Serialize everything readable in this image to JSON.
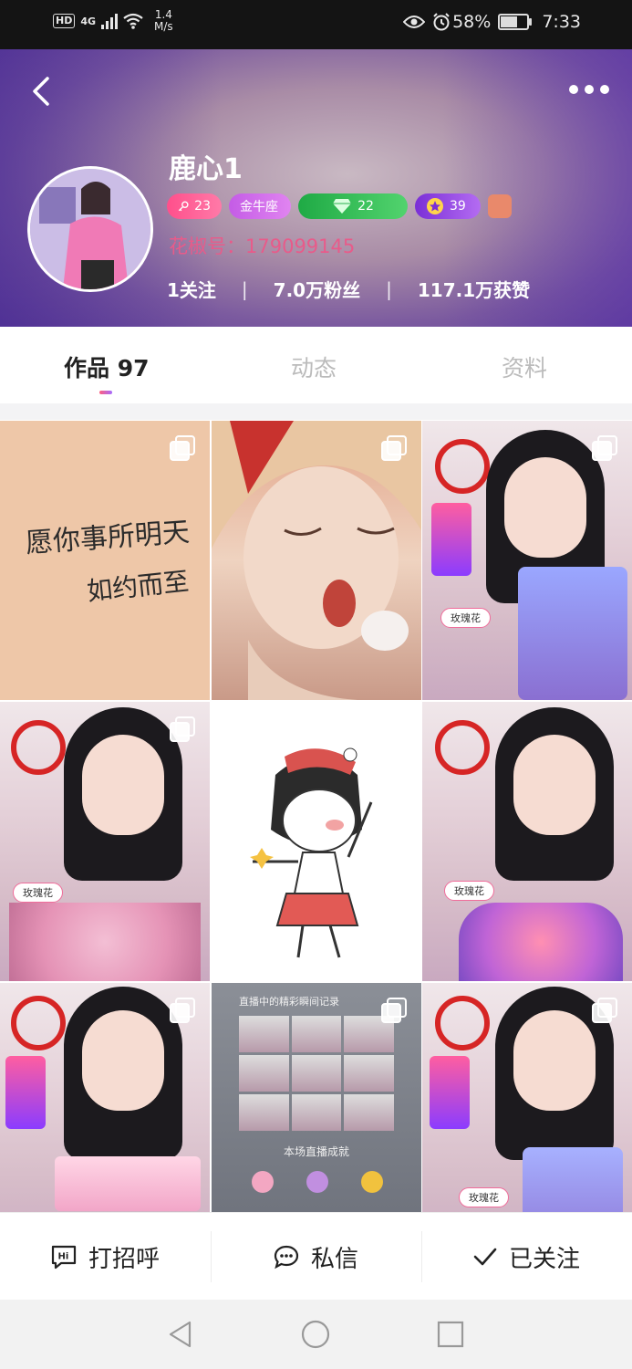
{
  "status_bar": {
    "left_badge": "HD",
    "network": "4G",
    "speed_value": "1.4",
    "speed_unit": "M/s",
    "battery": "58%",
    "time": "7:33",
    "battery_level": 0.58
  },
  "header": {
    "nickname": "鹿心1",
    "level_badge": "23",
    "zodiac_badge": "金牛座",
    "fans_badge": "22",
    "vip_badge": "39",
    "user_id": "花椒号：179099145",
    "stats": {
      "following": "1关注",
      "fans": "7.0万粉丝",
      "likes": "117.1万获赞",
      "separator": "|"
    }
  },
  "tabs": [
    {
      "label": "作品 97"
    },
    {
      "label": "动态"
    },
    {
      "label": "资料"
    }
  ],
  "grid": {
    "cell1": {
      "line1": "愿你事所明天",
      "line2": "如约而至"
    },
    "cell3": {
      "tag": "玫瑰花"
    },
    "cell4": {
      "tag": "玫瑰花"
    },
    "cell6": {
      "tag": "玫瑰花"
    },
    "cell8": {
      "title": "直播中的精彩瞬间记录",
      "subtitle": "本场直播成就"
    },
    "cell9": {
      "tag": "玫瑰花"
    }
  },
  "actions": {
    "greet": "打招呼",
    "message": "私信",
    "follow": "已关注"
  },
  "icons": {
    "back": "back-arrow-icon",
    "more": "more-dots-icon",
    "greet": "hi-bubble-icon",
    "message": "chat-bubble-icon",
    "follow": "checkmark-icon",
    "nav_back": "triangle-back-icon",
    "nav_home": "circle-home-icon",
    "nav_recent": "square-recents-icon"
  }
}
